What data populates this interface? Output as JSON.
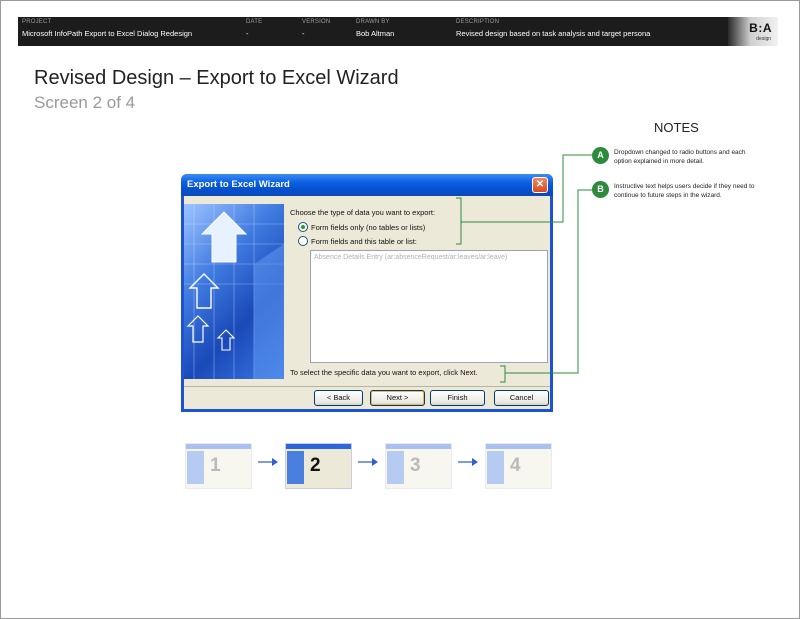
{
  "header": {
    "project_label": "PROJECT",
    "project_value": "Microsoft InfoPath Export to Excel Dialog Redesign",
    "date_label": "DATE",
    "date_value": "-",
    "version_label": "VERSION",
    "version_value": "-",
    "drawn_by_label": "DRAWN BY",
    "drawn_by_value": "Bob Altman",
    "description_label": "DESCRIPTION",
    "description_value": "Revised design based on task analysis and target persona",
    "logo_text": "B:A",
    "logo_sub": "design"
  },
  "page": {
    "title": "Revised Design – Export to Excel Wizard",
    "subtitle": "Screen 2 of 4"
  },
  "notes": {
    "title": "NOTES",
    "items": [
      {
        "badge": "A",
        "text": "Dropdown changed to radio buttons and each option explained in more detail."
      },
      {
        "badge": "B",
        "text": "Instructive text helps users decide if they need to continue to future steps in the wizard."
      }
    ],
    "accent_color": "#2e8b3e"
  },
  "dialog": {
    "title": "Export to Excel Wizard",
    "close_glyph": "✕",
    "prompt": "Choose the type of data you want to export:",
    "options": [
      {
        "label": "Form fields only (no tables or lists)",
        "selected": true
      },
      {
        "label": "Form fields and this table or list:",
        "selected": false
      }
    ],
    "list_item": "Absence Details Entry (ar:absenceRequest/ar:leaves/ar:leave)",
    "instruction": "To select the specific data you want to export, click Next.",
    "buttons": {
      "back": "< Back",
      "next": "Next >",
      "finish": "Finish",
      "cancel": "Cancel"
    }
  },
  "steps": [
    {
      "number": "1",
      "current": false
    },
    {
      "number": "2",
      "current": true
    },
    {
      "number": "3",
      "current": false
    },
    {
      "number": "4",
      "current": false
    }
  ],
  "icons": [
    "close-icon",
    "radio-selected-icon",
    "radio-unselected-icon",
    "arrow-right-icon",
    "wizard-graphic-arrows"
  ]
}
